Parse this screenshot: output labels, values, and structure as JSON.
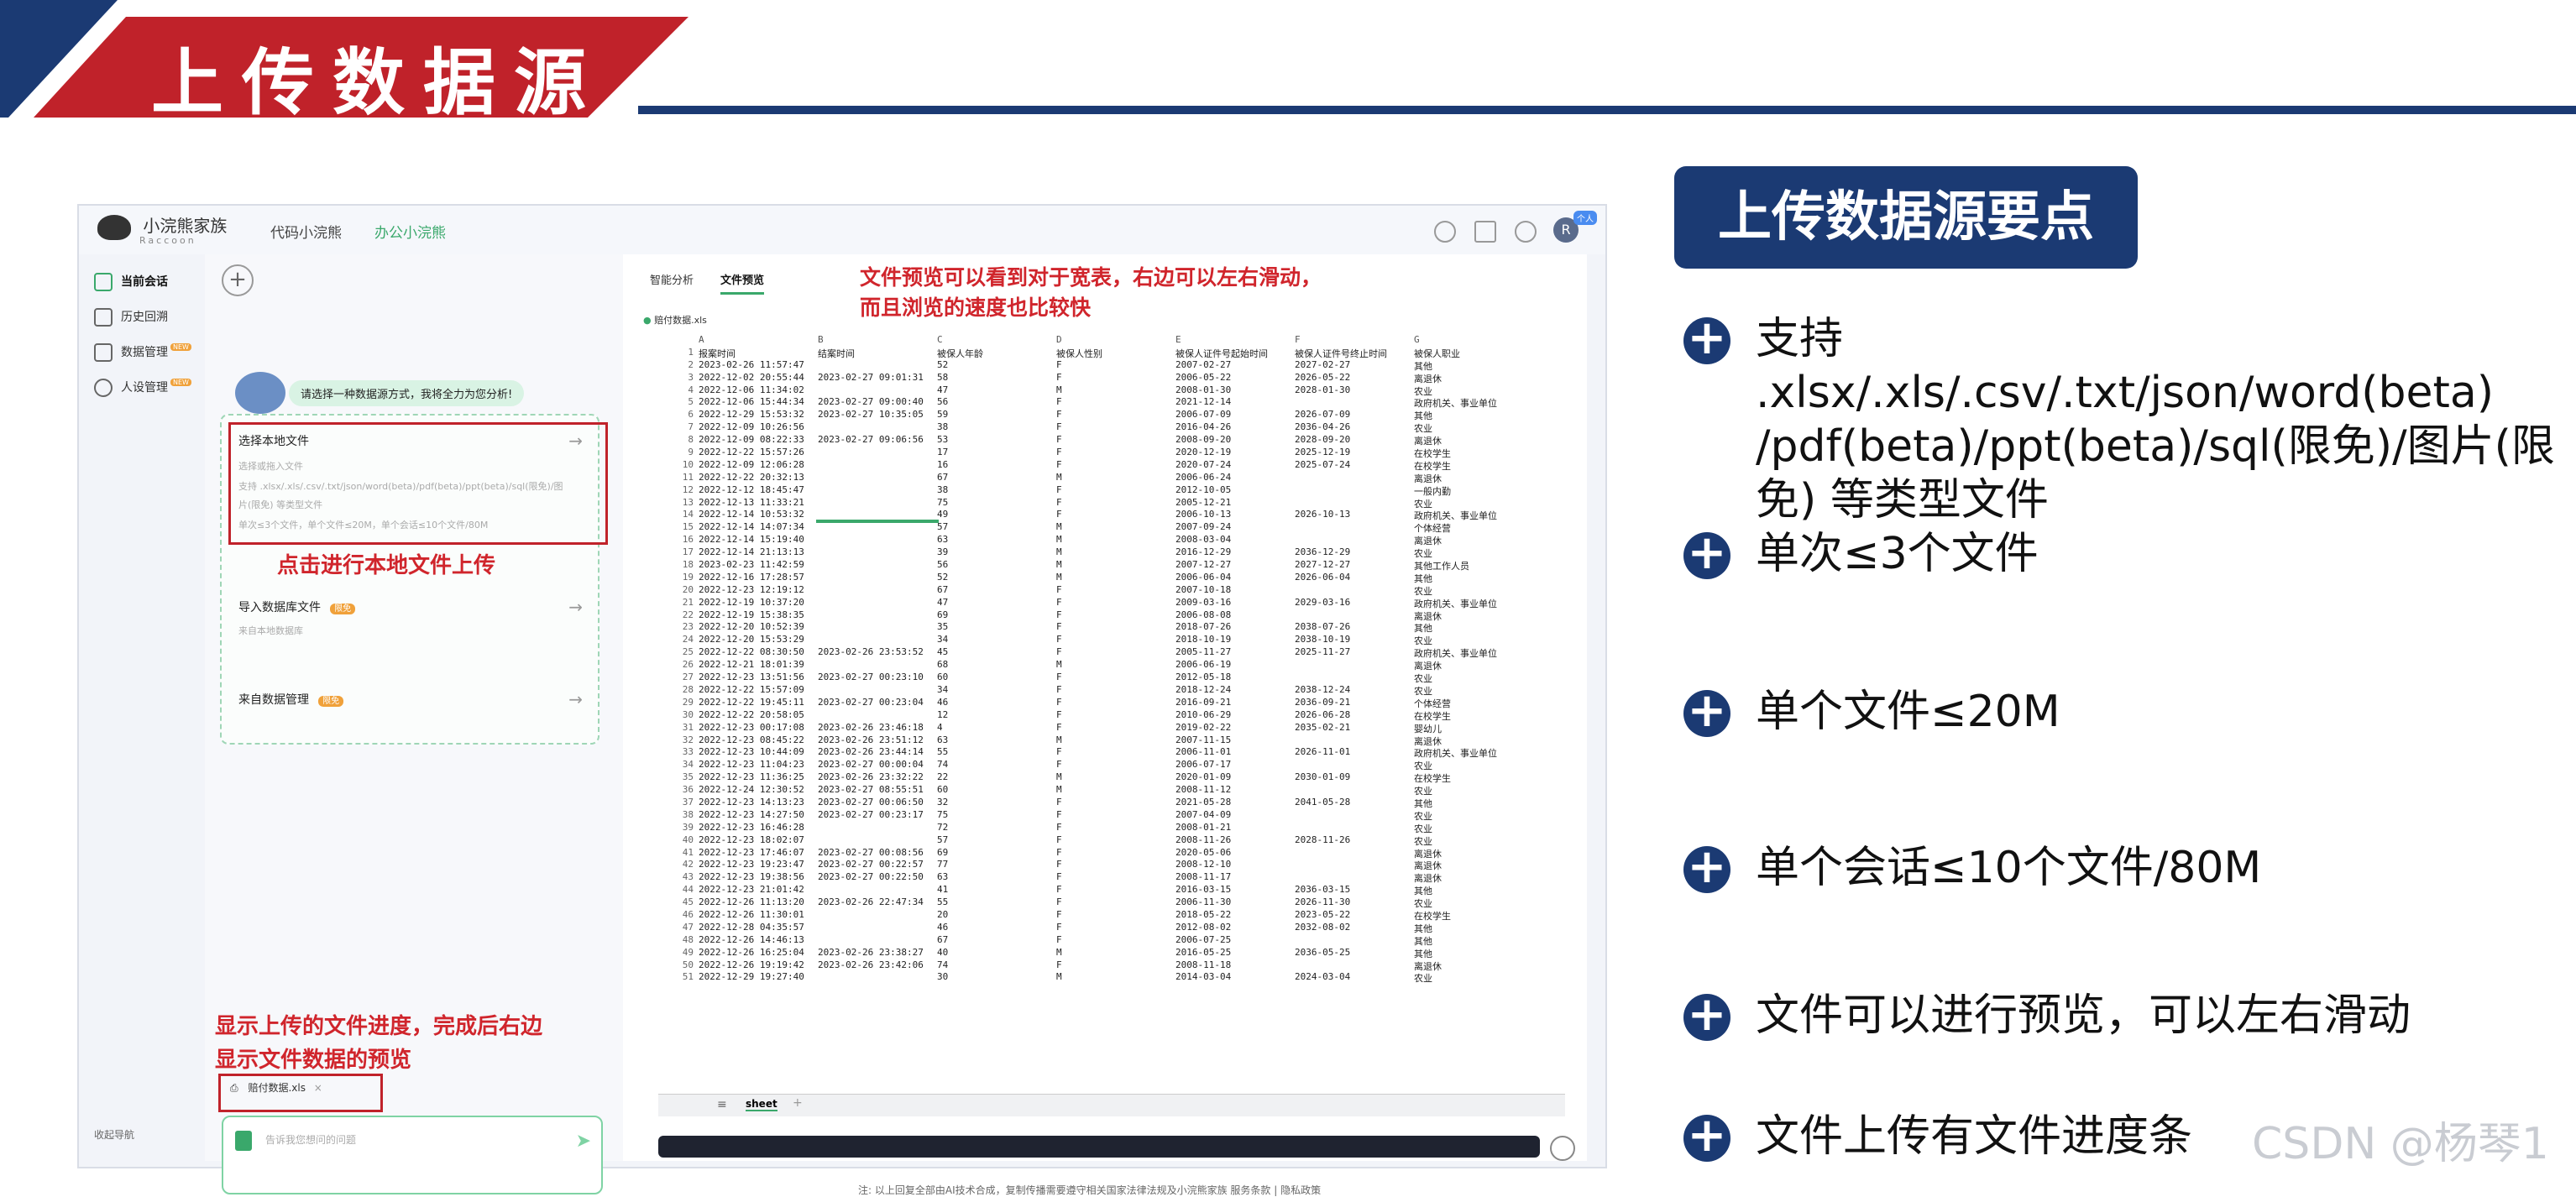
{
  "slide": {
    "title": "上传数据源",
    "watermark": "CSDN @杨琴1",
    "colors": {
      "red": "#c0222a",
      "navy": "#1b3a73",
      "green": "#3aa86b"
    }
  },
  "app": {
    "brand": "小浣熊家族",
    "brand_sub": "Raccoon",
    "nav_tabs": [
      "代码小浣熊",
      "办公小浣熊"
    ],
    "user_initial": "R",
    "user_badge": "个人",
    "sidebar": [
      "当前会话",
      "历史回溯",
      "数据管理",
      "人设管理"
    ],
    "sidebar_badge": "NEW",
    "collapse_nav": "收起导航",
    "assistant_hint": "请选择一种数据源方式，我将全力为您分析!",
    "option_local": {
      "title": "选择本地文件",
      "line1": "选择或拖入文件",
      "line2": "支持 .xlsx/.xls/.csv/.txt/json/word(beta)/pdf(beta)/ppt(beta)/sql(限免)/图",
      "line3": "片(限免) 等类型文件",
      "line4": "单次≤3个文件，单个文件≤20M，单个会话≤10个文件/80M"
    },
    "option_db": {
      "title": "导入数据库文件",
      "desc": "来自本地数据库",
      "badge": "限免"
    },
    "option_mgmt": {
      "title": "来自数据管理",
      "badge": "限免"
    },
    "uploaded_file": "赔付数据.xls",
    "input_placeholder": "告诉我您想问的问题",
    "preview_tabs": [
      "智能分析",
      "文件预览"
    ],
    "preview_file": "赔付数据.xls",
    "sheet_tab": "sheet",
    "footnote": "注: 以上回复全部由AI技术合成，复制传播需要遵守相关国家法律法规及小浣熊家族 服务条款 | 隐私政策"
  },
  "annotations": {
    "preview_note_1": "文件预览可以看到对于宽表，右边可以左右滑动，",
    "preview_note_2": "而且浏览的速度也比较快",
    "local_upload_note": "点击进行本地文件上传",
    "progress_note_1": "显示上传的文件进度，完成后右边",
    "progress_note_2": "显示文件数据的预览"
  },
  "spreadsheet": {
    "col_letters": [
      "A",
      "B",
      "C",
      "D",
      "E",
      "F",
      "G"
    ],
    "headers": [
      "报案时间",
      "结案时间",
      "被保人年龄",
      "被保人性别",
      "被保人证件号起始时间",
      "被保人证件号终止时间",
      "被保人职业"
    ],
    "rows": [
      [
        "2023-02-26 11:57:47",
        "",
        "52",
        "F",
        "2007-02-27",
        "2027-02-27",
        "其他"
      ],
      [
        "2022-12-02 20:55:44",
        "2023-02-27 09:01:31",
        "58",
        "F",
        "2006-05-22",
        "2026-05-22",
        "离退休"
      ],
      [
        "2022-12-06 11:34:02",
        "",
        "47",
        "M",
        "2008-01-30",
        "2028-01-30",
        "农业"
      ],
      [
        "2022-12-06 15:44:34",
        "2023-02-27 09:00:40",
        "56",
        "F",
        "2021-12-14",
        "",
        "政府机关、事业单位"
      ],
      [
        "2022-12-29 15:53:32",
        "2023-02-27 10:35:05",
        "59",
        "F",
        "2006-07-09",
        "2026-07-09",
        "其他"
      ],
      [
        "2022-12-09 10:26:56",
        "",
        "38",
        "F",
        "2016-04-26",
        "2036-04-26",
        "农业"
      ],
      [
        "2022-12-09 08:22:33",
        "2023-02-27 09:06:56",
        "53",
        "F",
        "2008-09-20",
        "2028-09-20",
        "离退休"
      ],
      [
        "2022-12-22 15:57:26",
        "",
        "17",
        "F",
        "2020-12-19",
        "2025-12-19",
        "在校学生"
      ],
      [
        "2022-12-09 12:06:28",
        "",
        "16",
        "F",
        "2020-07-24",
        "2025-07-24",
        "在校学生"
      ],
      [
        "2022-12-22 20:32:13",
        "",
        "67",
        "M",
        "2006-06-24",
        "",
        "离退休"
      ],
      [
        "2022-12-12 18:45:47",
        "",
        "38",
        "F",
        "2012-10-05",
        "",
        "一般内勤"
      ],
      [
        "2022-12-13 11:33:21",
        "",
        "75",
        "F",
        "2005-12-21",
        "",
        "农业"
      ],
      [
        "2022-12-14 10:53:32",
        "",
        "49",
        "F",
        "2006-10-13",
        "2026-10-13",
        "政府机关、事业单位"
      ],
      [
        "2022-12-14 14:07:34",
        "",
        "57",
        "M",
        "2007-09-24",
        "",
        "个体经营"
      ],
      [
        "2022-12-14 15:19:40",
        "",
        "63",
        "M",
        "2008-03-04",
        "",
        "离退休"
      ],
      [
        "2022-12-14 21:13:13",
        "",
        "39",
        "M",
        "2016-12-29",
        "2036-12-29",
        "农业"
      ],
      [
        "2023-02-23 11:42:59",
        "",
        "56",
        "M",
        "2007-12-27",
        "2027-12-27",
        "其他工作人员"
      ],
      [
        "2022-12-16 17:28:57",
        "",
        "52",
        "M",
        "2006-06-04",
        "2026-06-04",
        "其他"
      ],
      [
        "2022-12-23 12:19:12",
        "",
        "67",
        "F",
        "2007-10-18",
        "",
        "农业"
      ],
      [
        "2022-12-19 10:37:20",
        "",
        "47",
        "F",
        "2009-03-16",
        "2029-03-16",
        "政府机关、事业单位"
      ],
      [
        "2022-12-19 15:38:35",
        "",
        "69",
        "F",
        "2006-08-08",
        "",
        "离退休"
      ],
      [
        "2022-12-20 10:52:39",
        "",
        "35",
        "F",
        "2018-07-26",
        "2038-07-26",
        "其他"
      ],
      [
        "2022-12-20 15:53:29",
        "",
        "34",
        "F",
        "2018-10-19",
        "2038-10-19",
        "农业"
      ],
      [
        "2022-12-22 08:30:50",
        "2023-02-26 23:53:52",
        "45",
        "F",
        "2005-11-27",
        "2025-11-27",
        "政府机关、事业单位"
      ],
      [
        "2022-12-21 18:01:39",
        "",
        "68",
        "M",
        "2006-06-19",
        "",
        "离退休"
      ],
      [
        "2022-12-23 13:51:56",
        "2023-02-27 00:23:10",
        "60",
        "F",
        "2012-05-18",
        "",
        "农业"
      ],
      [
        "2022-12-22 15:57:09",
        "",
        "34",
        "F",
        "2018-12-24",
        "2038-12-24",
        "农业"
      ],
      [
        "2022-12-22 19:45:11",
        "2023-02-27 00:23:04",
        "46",
        "F",
        "2016-09-21",
        "2036-09-21",
        "个体经营"
      ],
      [
        "2022-12-22 20:58:05",
        "",
        "12",
        "F",
        "2010-06-29",
        "2026-06-28",
        "在校学生"
      ],
      [
        "2022-12-23 00:17:08",
        "2023-02-26 23:46:18",
        "4",
        "F",
        "2019-02-22",
        "2035-02-21",
        "婴幼儿"
      ],
      [
        "2022-12-23 08:45:22",
        "2023-02-26 23:51:12",
        "63",
        "M",
        "2007-11-15",
        "",
        "离退休"
      ],
      [
        "2022-12-23 10:44:09",
        "2023-02-26 23:44:14",
        "55",
        "F",
        "2006-11-01",
        "2026-11-01",
        "政府机关、事业单位"
      ],
      [
        "2022-12-23 11:04:23",
        "2023-02-27 00:00:04",
        "74",
        "F",
        "2006-07-17",
        "",
        "农业"
      ],
      [
        "2022-12-23 11:36:25",
        "2023-02-26 23:32:22",
        "22",
        "M",
        "2020-01-09",
        "2030-01-09",
        "在校学生"
      ],
      [
        "2022-12-24 12:30:52",
        "2023-02-27 08:55:51",
        "60",
        "M",
        "2008-11-12",
        "",
        "农业"
      ],
      [
        "2022-12-23 14:13:23",
        "2023-02-27 00:06:50",
        "32",
        "F",
        "2021-05-28",
        "2041-05-28",
        "其他"
      ],
      [
        "2022-12-23 14:27:50",
        "2023-02-27 00:23:17",
        "75",
        "F",
        "2007-04-09",
        "",
        "农业"
      ],
      [
        "2022-12-23 16:46:28",
        "",
        "72",
        "F",
        "2008-01-21",
        "",
        "农业"
      ],
      [
        "2022-12-23 18:02:07",
        "",
        "57",
        "F",
        "2008-11-26",
        "2028-11-26",
        "农业"
      ],
      [
        "2022-12-23 17:46:07",
        "2023-02-27 00:08:56",
        "69",
        "F",
        "2020-05-06",
        "",
        "离退休"
      ],
      [
        "2022-12-23 19:23:47",
        "2023-02-27 00:22:57",
        "77",
        "F",
        "2008-12-10",
        "",
        "离退休"
      ],
      [
        "2022-12-23 19:38:56",
        "2023-02-27 00:22:50",
        "63",
        "F",
        "2008-11-17",
        "",
        "离退休"
      ],
      [
        "2022-12-23 21:01:42",
        "",
        "41",
        "F",
        "2016-03-15",
        "2036-03-15",
        "其他"
      ],
      [
        "2022-12-26 11:13:20",
        "2023-02-26 22:47:34",
        "55",
        "F",
        "2006-11-30",
        "2026-11-30",
        "农业"
      ],
      [
        "2022-12-26 11:30:01",
        "",
        "20",
        "F",
        "2018-05-22",
        "2023-05-22",
        "在校学生"
      ],
      [
        "2022-12-28 04:35:57",
        "",
        "46",
        "F",
        "2012-08-02",
        "2032-08-02",
        "其他"
      ],
      [
        "2022-12-26 14:46:13",
        "",
        "67",
        "F",
        "2006-07-25",
        "",
        "其他"
      ],
      [
        "2022-12-26 16:25:04",
        "2023-02-26 23:38:27",
        "40",
        "M",
        "2016-05-25",
        "2036-05-25",
        "其他"
      ],
      [
        "2022-12-26 19:19:42",
        "2023-02-26 23:42:06",
        "74",
        "F",
        "2008-11-18",
        "",
        "离退休"
      ],
      [
        "2022-12-29 19:27:40",
        "",
        "30",
        "M",
        "2014-03-04",
        "2024-03-04",
        "农业"
      ]
    ]
  },
  "key_points": {
    "title": "上传数据源要点",
    "items": [
      "支持 .xlsx/.xls/.csv/.txt/json/word(beta)",
      "/pdf(beta)/ppt(beta)/sql(限免)/图片(限",
      "免) 等类型文件",
      "单次≤3个文件",
      "单个文件≤20M",
      "单个会话≤10个文件/80M",
      "文件可以进行预览，可以左右滑动",
      "文件上传有文件进度条"
    ]
  }
}
